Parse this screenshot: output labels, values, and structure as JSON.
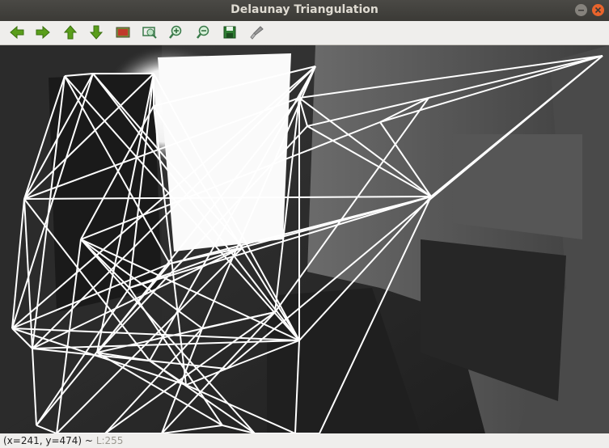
{
  "window": {
    "title": "Delaunay Triangulation"
  },
  "toolbar": {
    "buttons": [
      {
        "icon": "arrow-left-icon",
        "label": "Pan left",
        "color": "#5a9e1b"
      },
      {
        "icon": "arrow-right-icon",
        "label": "Pan right",
        "color": "#5a9e1b"
      },
      {
        "icon": "arrow-up-icon",
        "label": "Pan up",
        "color": "#5a9e1b"
      },
      {
        "icon": "arrow-down-icon",
        "label": "Pan down",
        "color": "#5a9e1b"
      },
      {
        "icon": "zoom-original-icon",
        "label": "Zoom original",
        "color": "#c0392b"
      },
      {
        "icon": "zoom-fit-icon",
        "label": "Zoom fit",
        "color": "#3a7a4a"
      },
      {
        "icon": "zoom-in-icon",
        "label": "Zoom in",
        "color": "#3a7a4a"
      },
      {
        "icon": "zoom-out-icon",
        "label": "Zoom out",
        "color": "#3a7a4a"
      },
      {
        "icon": "save-icon",
        "label": "Save",
        "color": "#2e7d32"
      },
      {
        "icon": "properties-icon",
        "label": "Properties",
        "color": "#8a8a8a"
      }
    ]
  },
  "status": {
    "coords": "(x=241, y=474) ~",
    "value": "L:255"
  },
  "colors": {
    "titlebar": "#3c3b37",
    "close": "#e9642c",
    "lines": "#ffffff"
  }
}
